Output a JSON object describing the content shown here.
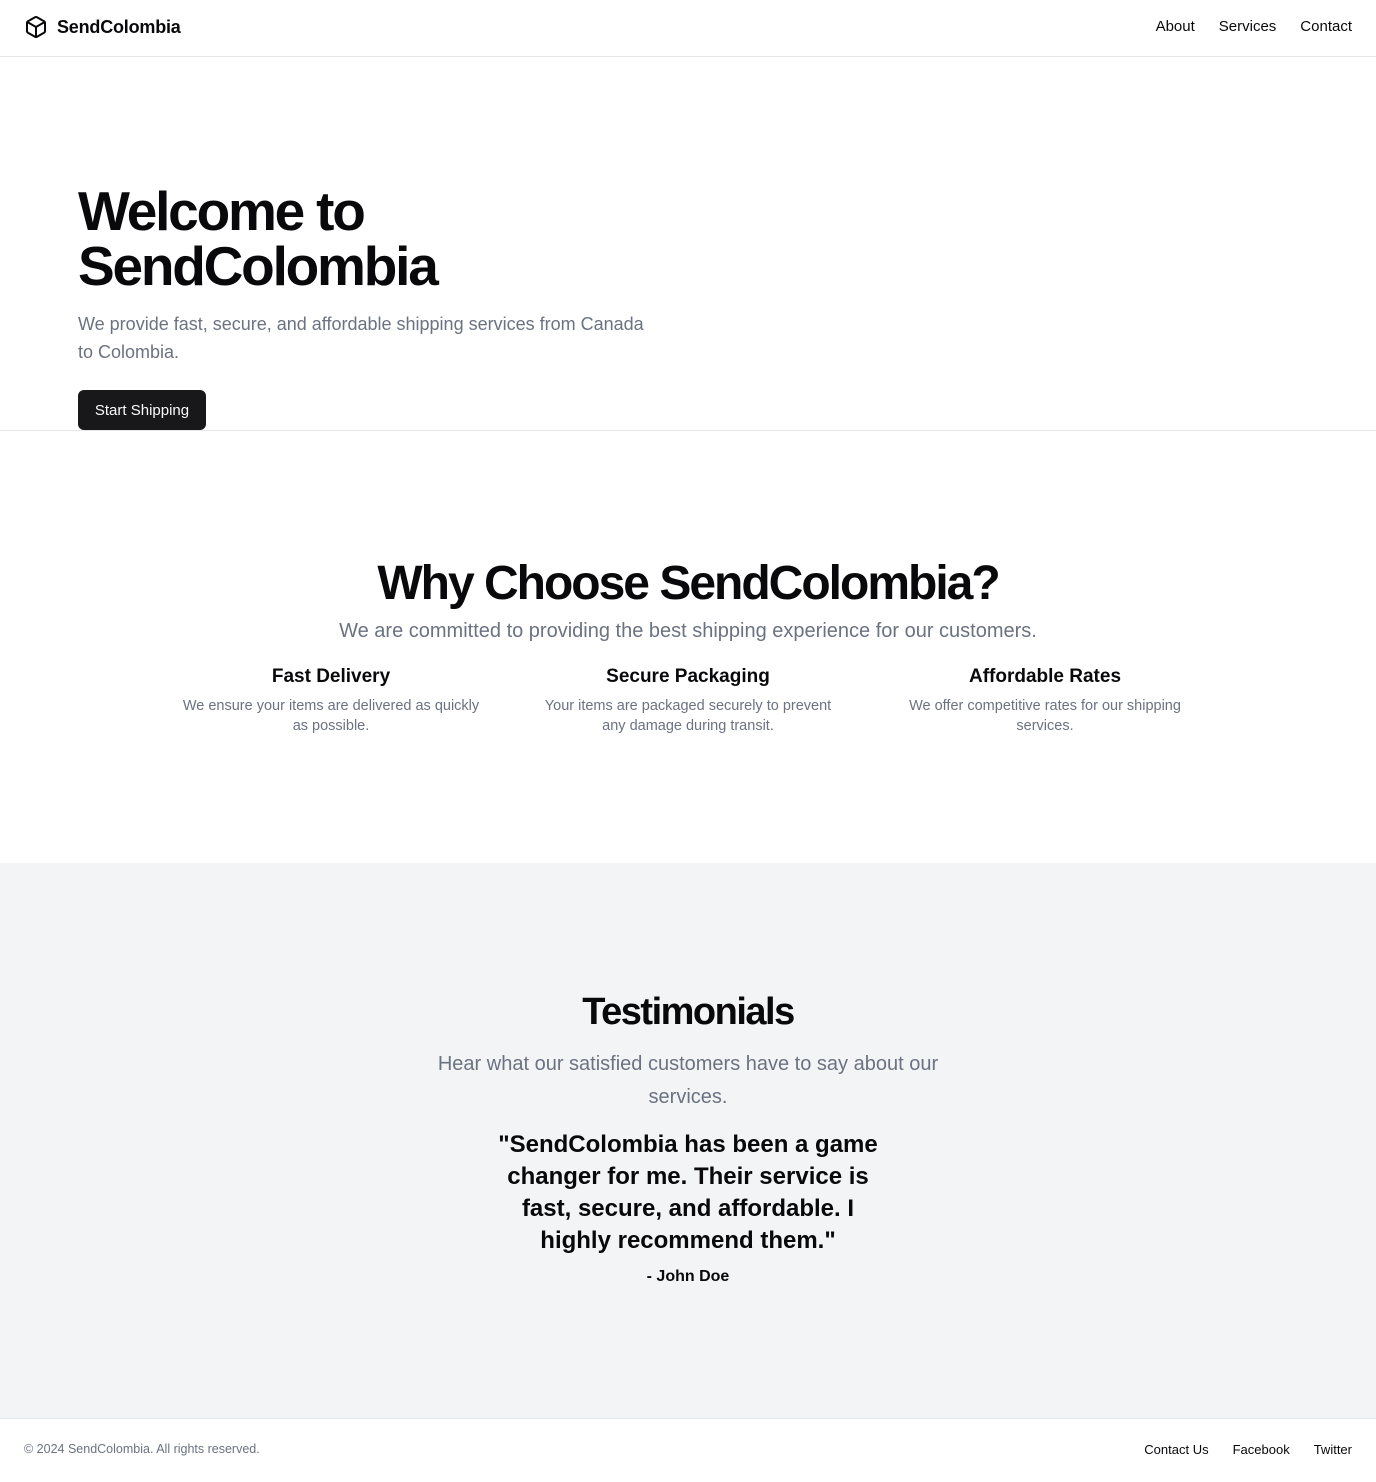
{
  "header": {
    "brand": "SendColombia",
    "brand_icon": "package-icon",
    "nav": [
      "About",
      "Services",
      "Contact"
    ]
  },
  "hero": {
    "title_line1": "Welcome to",
    "title_line2": "SendColombia",
    "subtitle": "We provide fast, secure, and affordable shipping services from Canada to Colombia.",
    "cta": "Start Shipping"
  },
  "features": {
    "title": "Why Choose SendColombia?",
    "subtitle": "We are committed to providing the best shipping experience for our customers.",
    "items": [
      {
        "title": "Fast Delivery",
        "description": "We ensure your items are delivered as quickly as possible."
      },
      {
        "title": "Secure Packaging",
        "description": "Your items are packaged securely to prevent any damage during transit."
      },
      {
        "title": "Affordable Rates",
        "description": "We offer competitive rates for our shipping services."
      }
    ]
  },
  "testimonials": {
    "title": "Testimonials",
    "subtitle": "Hear what our satisfied customers have to say about our services.",
    "quote": "\"SendColombia has been a game changer for me. Their service is fast, secure, and affordable. I highly recommend them.\"",
    "author": "- John Doe"
  },
  "footer": {
    "copyright": "© 2024 SendColombia. All rights reserved.",
    "links": [
      "Contact Us",
      "Facebook",
      "Twitter"
    ]
  },
  "colors": {
    "primary": "#18181b",
    "muted_text": "#6b7280",
    "section_bg": "#f3f4f6",
    "border": "#e5e7eb"
  }
}
